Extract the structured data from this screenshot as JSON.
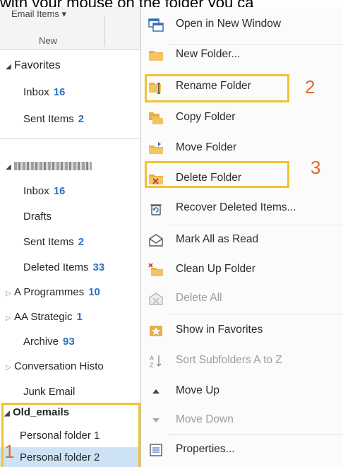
{
  "caption": "with your mouse on the folder you ca",
  "ribbon": {
    "email_items": "Email Items ▾",
    "new_label": "New"
  },
  "favorites": {
    "title": "Favorites",
    "items": [
      {
        "label": "Inbox",
        "count": "16"
      },
      {
        "label": "Sent Items",
        "count": "2"
      }
    ]
  },
  "account": {
    "items": [
      {
        "label": "Inbox",
        "count": "16"
      },
      {
        "label": "Drafts",
        "count": ""
      },
      {
        "label": "Sent Items",
        "count": "2"
      },
      {
        "label": "Deleted Items",
        "count": "33"
      },
      {
        "label": "A Programmes",
        "count": "10"
      },
      {
        "label": "AA Strategic",
        "count": "1"
      },
      {
        "label": "Archive",
        "count": "93"
      },
      {
        "label": "Conversation Histo",
        "count": ""
      },
      {
        "label": "Junk Email",
        "count": ""
      }
    ]
  },
  "old_emails": {
    "title": "Old_emails",
    "items": [
      {
        "label": "Personal folder 1"
      },
      {
        "label": "Personal folder 2"
      }
    ]
  },
  "annotations": {
    "one": "1",
    "two": "2",
    "three": "3"
  },
  "menu": {
    "items": [
      {
        "label": "Open in New Window",
        "icon": "new-window-icon",
        "enabled": true
      },
      {
        "label": "New Folder...",
        "icon": "new-folder-icon",
        "enabled": true
      },
      {
        "label": "Rename Folder",
        "icon": "rename-folder-icon",
        "enabled": true
      },
      {
        "label": "Copy Folder",
        "icon": "copy-folder-icon",
        "enabled": true
      },
      {
        "label": "Move Folder",
        "icon": "move-folder-icon",
        "enabled": true
      },
      {
        "label": "Delete Folder",
        "icon": "delete-folder-icon",
        "enabled": true
      },
      {
        "label": "Recover Deleted Items...",
        "icon": "recover-items-icon",
        "enabled": true
      },
      {
        "label": "Mark All as Read",
        "icon": "envelope-open-icon",
        "enabled": true
      },
      {
        "label": "Clean Up Folder",
        "icon": "clean-up-icon",
        "enabled": true
      },
      {
        "label": "Delete All",
        "icon": "delete-all-icon",
        "enabled": false
      },
      {
        "label": "Show in Favorites",
        "icon": "favorites-star-icon",
        "enabled": true
      },
      {
        "label": "Sort Subfolders A to Z",
        "icon": "sort-az-icon",
        "enabled": false
      },
      {
        "label": "Move Up",
        "icon": "arrow-up-icon",
        "enabled": true
      },
      {
        "label": "Move Down",
        "icon": "arrow-down-icon",
        "enabled": false
      },
      {
        "label": "Properties...",
        "icon": "properties-icon",
        "enabled": true
      }
    ]
  },
  "colors": {
    "highlight_box": "#f1c232",
    "annotation_number": "#e06c28",
    "count": "#2b72c2",
    "selected_row": "#cde3f5"
  }
}
